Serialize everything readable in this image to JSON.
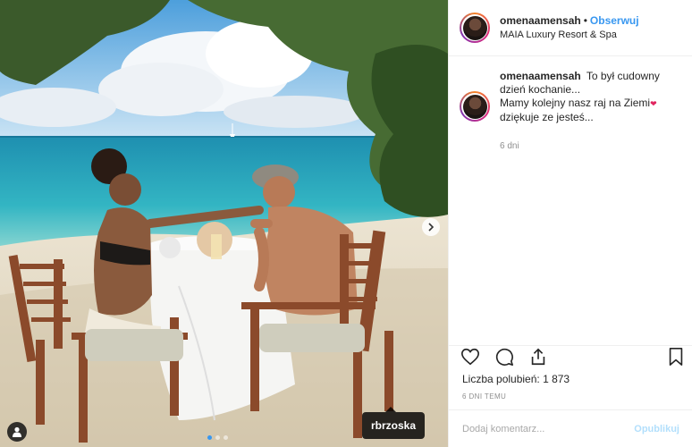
{
  "post": {
    "username": "omenaamensah",
    "follow_label": "Obserwuj",
    "location": "MAIA Luxury Resort & Spa",
    "caption_line1": "To był cudowny dzień kochanie...",
    "caption_line2": "Mamy kolejny nasz raj na Ziemi",
    "caption_line3": "dziękuje ze jesteś...",
    "caption_emoji": "❤",
    "time_ago": "6 dni",
    "likes_label": "Liczba polubień:",
    "likes_count": "1 873",
    "date": "6 DNI TEMU",
    "comment_placeholder": "Dodaj komentarz...",
    "publish_label": "Opublikuj"
  },
  "photo": {
    "tag_user": "rbrzoska",
    "carousel_total": 3,
    "carousel_active": 1
  },
  "icons": {
    "like": "heart-icon",
    "comment": "comment-icon",
    "share": "share-icon",
    "save": "bookmark-icon",
    "next": "chevron-right-icon",
    "user_tags": "user-icon"
  },
  "colors": {
    "link": "#3897f0",
    "muted": "#8e8e8e",
    "publish_disabled": "#b2dffc"
  }
}
